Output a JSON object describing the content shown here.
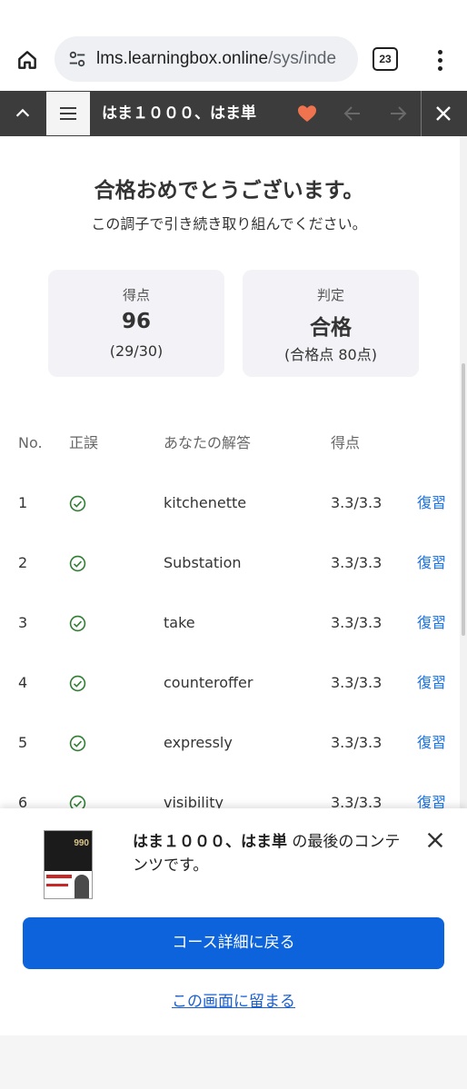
{
  "browser": {
    "url_host": "lms.learningbox.online",
    "url_path": "/sys/inde",
    "tab_count": "23"
  },
  "header": {
    "title": "はま１０００、はま単"
  },
  "result": {
    "heading": "合格おめでとうございます。",
    "message": "この調子で引き続き取り組んでください。",
    "score_label": "得点",
    "score_value": "96",
    "score_detail": "(29/30)",
    "judge_label": "判定",
    "judge_value": "合格",
    "judge_detail": "(合格点 80点)"
  },
  "table": {
    "headers": {
      "no": "No.",
      "correct": "正誤",
      "answer": "あなたの解答",
      "points": "得点"
    },
    "review_label": "復習",
    "rows": [
      {
        "no": "1",
        "answer": "kitchenette",
        "points": "3.3/3.3"
      },
      {
        "no": "2",
        "answer": "Substation",
        "points": "3.3/3.3"
      },
      {
        "no": "3",
        "answer": "take",
        "points": "3.3/3.3"
      },
      {
        "no": "4",
        "answer": "counteroffer",
        "points": "3.3/3.3"
      },
      {
        "no": "5",
        "answer": "expressly",
        "points": "3.3/3.3"
      },
      {
        "no": "6",
        "answer": "visibility",
        "points": "3.3/3.3"
      }
    ]
  },
  "sheet": {
    "course_name": "はま１０００、はま単",
    "message_suffix": " の最後のコンテンツです。",
    "book_badge": "990",
    "primary_button": "コース詳細に戻る",
    "stay_link": "この画面に留まる"
  },
  "colors": {
    "accent": "#0c63dc",
    "link": "#1a73e8",
    "header_bg": "#3c3c3c",
    "heart": "#f0734f",
    "check": "#2e7d32"
  }
}
